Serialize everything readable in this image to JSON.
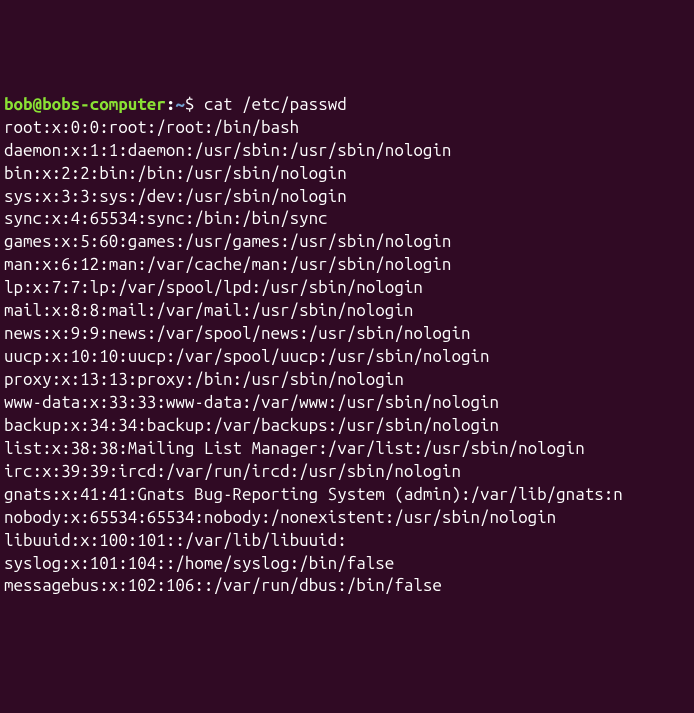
{
  "prompt": {
    "user_host": "bob@bobs-computer",
    "separator": ":",
    "path": "~",
    "symbol": "$ "
  },
  "command": "cat /etc/passwd",
  "output": [
    "root:x:0:0:root:/root:/bin/bash",
    "daemon:x:1:1:daemon:/usr/sbin:/usr/sbin/nologin",
    "bin:x:2:2:bin:/bin:/usr/sbin/nologin",
    "sys:x:3:3:sys:/dev:/usr/sbin/nologin",
    "sync:x:4:65534:sync:/bin:/bin/sync",
    "games:x:5:60:games:/usr/games:/usr/sbin/nologin",
    "man:x:6:12:man:/var/cache/man:/usr/sbin/nologin",
    "lp:x:7:7:lp:/var/spool/lpd:/usr/sbin/nologin",
    "mail:x:8:8:mail:/var/mail:/usr/sbin/nologin",
    "news:x:9:9:news:/var/spool/news:/usr/sbin/nologin",
    "uucp:x:10:10:uucp:/var/spool/uucp:/usr/sbin/nologin",
    "proxy:x:13:13:proxy:/bin:/usr/sbin/nologin",
    "www-data:x:33:33:www-data:/var/www:/usr/sbin/nologin",
    "backup:x:34:34:backup:/var/backups:/usr/sbin/nologin",
    "list:x:38:38:Mailing List Manager:/var/list:/usr/sbin/nologin",
    "irc:x:39:39:ircd:/var/run/ircd:/usr/sbin/nologin",
    "gnats:x:41:41:Gnats Bug-Reporting System (admin):/var/lib/gnats:n",
    "nobody:x:65534:65534:nobody:/nonexistent:/usr/sbin/nologin",
    "libuuid:x:100:101::/var/lib/libuuid:",
    "syslog:x:101:104::/home/syslog:/bin/false",
    "messagebus:x:102:106::/var/run/dbus:/bin/false"
  ]
}
